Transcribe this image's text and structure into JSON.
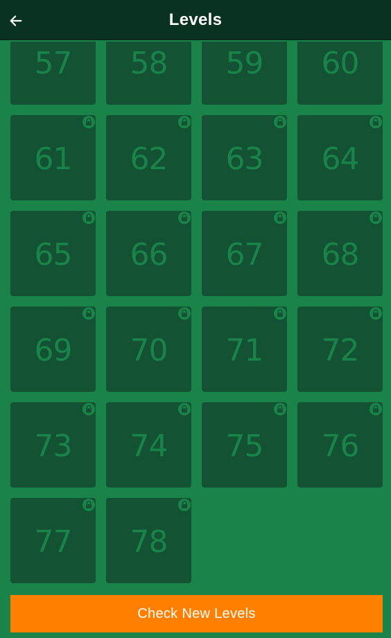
{
  "header": {
    "title": "Levels",
    "back_icon": "arrow-left-icon"
  },
  "levels": [
    {
      "number": "57",
      "locked": false
    },
    {
      "number": "58",
      "locked": false
    },
    {
      "number": "59",
      "locked": false
    },
    {
      "number": "60",
      "locked": false
    },
    {
      "number": "61",
      "locked": true
    },
    {
      "number": "62",
      "locked": true
    },
    {
      "number": "63",
      "locked": true
    },
    {
      "number": "64",
      "locked": true
    },
    {
      "number": "65",
      "locked": true
    },
    {
      "number": "66",
      "locked": true
    },
    {
      "number": "67",
      "locked": true
    },
    {
      "number": "68",
      "locked": true
    },
    {
      "number": "69",
      "locked": true
    },
    {
      "number": "70",
      "locked": true
    },
    {
      "number": "71",
      "locked": true
    },
    {
      "number": "72",
      "locked": true
    },
    {
      "number": "73",
      "locked": true
    },
    {
      "number": "74",
      "locked": true
    },
    {
      "number": "75",
      "locked": true
    },
    {
      "number": "76",
      "locked": true
    },
    {
      "number": "77",
      "locked": true
    },
    {
      "number": "78",
      "locked": true
    }
  ],
  "lock_icon": "lock-icon",
  "footer": {
    "button_label": "Check New Levels"
  },
  "colors": {
    "background": "#1a8349",
    "header": "#0a3221",
    "tile": "#145234",
    "tile_number": "#1a8349",
    "button": "#ff8000",
    "button_text": "#ffffff"
  }
}
